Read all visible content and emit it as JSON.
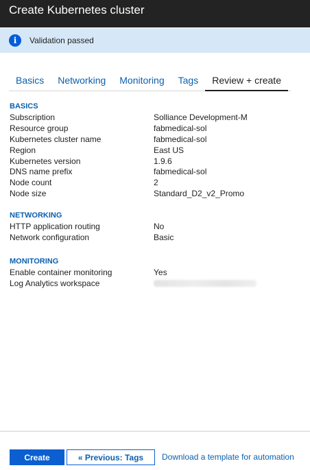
{
  "window": {
    "title": "Create Kubernetes cluster"
  },
  "banner": {
    "icon": "info-icon",
    "message": "Validation passed"
  },
  "tabs": [
    {
      "label": "Basics"
    },
    {
      "label": "Networking"
    },
    {
      "label": "Monitoring"
    },
    {
      "label": "Tags"
    },
    {
      "label": "Review + create",
      "active": true
    }
  ],
  "basics": {
    "title": "BASICS",
    "rows": [
      {
        "key": "Subscription",
        "value": "Solliance Development-M"
      },
      {
        "key": "Resource group",
        "value": "fabmedical-sol"
      },
      {
        "key": "Kubernetes cluster name",
        "value": "fabmedical-sol"
      },
      {
        "key": "Region",
        "value": "East US"
      },
      {
        "key": "Kubernetes version",
        "value": "1.9.6"
      },
      {
        "key": "DNS name prefix",
        "value": "fabmedical-sol"
      },
      {
        "key": "Node count",
        "value": "2"
      },
      {
        "key": "Node size",
        "value": "Standard_D2_v2_Promo"
      }
    ]
  },
  "networking": {
    "title": "NETWORKING",
    "rows": [
      {
        "key": "HTTP application routing",
        "value": "No"
      },
      {
        "key": "Network configuration",
        "value": "Basic"
      }
    ]
  },
  "monitoring": {
    "title": "MONITORING",
    "rows": [
      {
        "key": "Enable container monitoring",
        "value": "Yes"
      },
      {
        "key": "Log Analytics workspace",
        "value": ""
      }
    ]
  },
  "footer": {
    "create_label": "Create",
    "previous_label": "« Previous: Tags",
    "download_label": "Download a template for automation"
  },
  "colors": {
    "accent": "#0b5fd0",
    "banner_bg": "#d6e8f7",
    "titlebar_bg": "#232323",
    "section_title": "#0b5fae"
  }
}
